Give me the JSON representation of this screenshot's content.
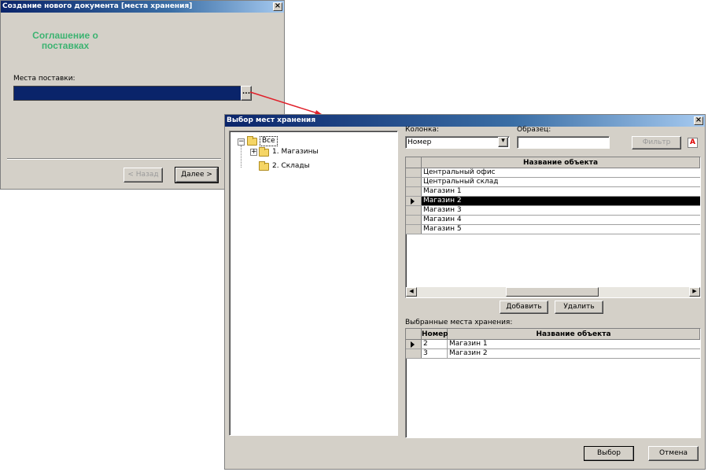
{
  "back_window": {
    "title": "Создание нового документа [места хранения]",
    "heading": "Соглашение о поставках",
    "field_label": "Места поставки:",
    "field_value": "",
    "browse_label": "...",
    "back_button": "< Назад",
    "next_button": "Далее >"
  },
  "dialog": {
    "title": "Выбор мест хранения",
    "tree": {
      "root": "Все",
      "items": [
        "1. Магазины",
        "2. Склады"
      ]
    },
    "filter": {
      "column_label": "Колонка:",
      "column_value": "Номер",
      "pattern_label": "Образец:",
      "pattern_value": "",
      "filter_button": "Фильтр",
      "case_icon_label": "A"
    },
    "objects_grid": {
      "header": "Название объекта",
      "rows": [
        "Центральный офис",
        "Центральный склад",
        "Магазин 1",
        "Магазин 2",
        "Магазин 3",
        "Магазин 4",
        "Магазин 5"
      ],
      "selected_index": 3
    },
    "add_button": "Добавить",
    "remove_button": "Удалить",
    "selected_label": "Выбранные места хранения:",
    "selected_grid": {
      "col_number": "Номер",
      "col_name": "Название объекта",
      "rows": [
        {
          "number": "2",
          "name": "Магазин 1"
        },
        {
          "number": "3",
          "name": "Магазин 2"
        }
      ]
    },
    "ok_button": "Выбор",
    "cancel_button": "Отмена"
  },
  "colors": {
    "title_blue": "#0a246a",
    "heading_green": "#3cb371",
    "selected_field": "#0a246a",
    "connector_red": "#e0202a"
  }
}
